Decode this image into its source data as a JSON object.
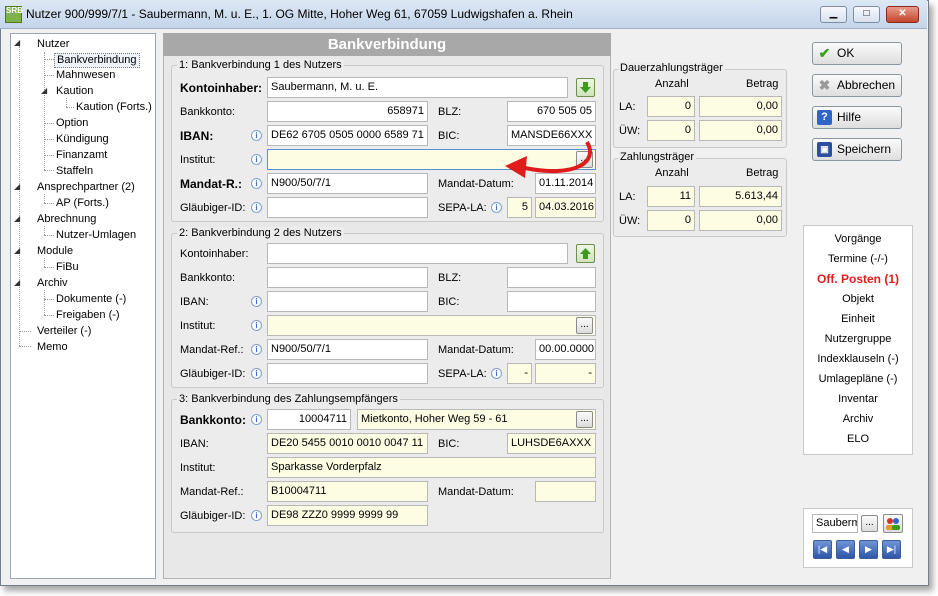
{
  "window": {
    "title": "Nutzer 900/999/7/1 - Saubermann, M. u. E., 1. OG Mitte, Hoher Weg 61, 67059 Ludwigshafen a. Rhein",
    "app_icon_text": "SRB",
    "min": "▁",
    "max": "□",
    "close": "✕"
  },
  "tree": {
    "nutzer": "Nutzer",
    "bankverbindung": "Bankverbindung",
    "mahnwesen": "Mahnwesen",
    "kaution": "Kaution",
    "kaution_forts": "Kaution (Forts.)",
    "option": "Option",
    "kuendigung": "Kündigung",
    "finanzamt": "Finanzamt",
    "staffeln": "Staffeln",
    "ansprechpartner": "Ansprechpartner (2)",
    "ap_forts": "AP (Forts.)",
    "abrechnung": "Abrechnung",
    "nutzer_umlagen": "Nutzer-Umlagen",
    "module": "Module",
    "fibu": "FiBu",
    "archiv": "Archiv",
    "dokumente": "Dokumente (-)",
    "freigaben": "Freigaben (-)",
    "verteiler": "Verteiler (-)",
    "memo": "Memo"
  },
  "main": {
    "title": "Bankverbindung"
  },
  "bank1": {
    "group_title": "1: Bankverbindung 1 des Nutzers",
    "kontoinhaber_label": "Kontoinhaber:",
    "kontoinhaber": "Saubermann, M. u. E.",
    "bankkonto_label": "Bankkonto:",
    "bankkonto": "658971",
    "blz_label": "BLZ:",
    "blz": "670 505 05",
    "iban_label": "IBAN:",
    "iban": "DE62 6705 0505 0000 6589 71",
    "bic_label": "BIC:",
    "bic": "MANSDE66XXX",
    "institut_label": "Institut:",
    "institut": "",
    "mandat_label": "Mandat-R.:",
    "mandat": "N900/50/7/1",
    "mandat_datum_label": "Mandat-Datum:",
    "mandat_datum": "01.11.2014",
    "glaeubiger_label": "Gläubiger-ID:",
    "glaeubiger": "",
    "sepa_label": "SEPA-LA:",
    "sepa_count": "5",
    "sepa_date": "04.03.2016"
  },
  "bank2": {
    "group_title": "2: Bankverbindung 2 des Nutzers",
    "kontoinhaber_label": "Kontoinhaber:",
    "kontoinhaber": "",
    "bankkonto_label": "Bankkonto:",
    "bankkonto": "",
    "blz_label": "BLZ:",
    "blz": "",
    "iban_label": "IBAN:",
    "iban": "",
    "bic_label": "BIC:",
    "bic": "",
    "institut_label": "Institut:",
    "institut": "",
    "mandat_label": "Mandat-Ref.:",
    "mandat": "N900/50/7/1",
    "mandat_datum_label": "Mandat-Datum:",
    "mandat_datum": "00.00.0000",
    "glaeubiger_label": "Gläubiger-ID:",
    "glaeubiger": "",
    "sepa_label": "SEPA-LA:",
    "sepa_count": "-",
    "sepa_date": "-"
  },
  "bank3": {
    "group_title": "3: Bankverbindung des Zahlungsempfängers",
    "bankkonto_label": "Bankkonto:",
    "bankkonto": "10004711",
    "konto_desc": "Mietkonto,  Hoher Weg 59 - 61",
    "iban_label": "IBAN:",
    "iban": "DE20 5455 0010 0010 0047 11",
    "bic_label": "BIC:",
    "bic": "LUHSDE6AXXX",
    "institut_label": "Institut:",
    "institut": "Sparkasse Vorderpfalz",
    "mandat_label": "Mandat-Ref.:",
    "mandat": "B10004711",
    "mandat_datum_label": "Mandat-Datum:",
    "mandat_datum": "",
    "glaeubiger_label": "Gläubiger-ID:",
    "glaeubiger": "DE98 ZZZ0 9999 9999 99"
  },
  "dauer": {
    "title": "Dauerzahlungsträger",
    "anzahl_label": "Anzahl",
    "betrag_label": "Betrag",
    "la_label": "LA:",
    "la_anzahl": "0",
    "la_betrag": "0,00",
    "uew_label": "ÜW:",
    "uew_anzahl": "0",
    "uew_betrag": "0,00"
  },
  "zahl": {
    "title": "Zahlungsträger",
    "anzahl_label": "Anzahl",
    "betrag_label": "Betrag",
    "la_label": "LA:",
    "la_anzahl": "11",
    "la_betrag": "5.613,44",
    "uew_label": "ÜW:",
    "uew_anzahl": "0",
    "uew_betrag": "0,00"
  },
  "buttons": {
    "ok": "OK",
    "abbrechen": "Abbrechen",
    "hilfe": "Hilfe",
    "speichern": "Speichern"
  },
  "links": {
    "vorgaenge": "Vorgänge",
    "termine": "Termine (-/-)",
    "off_posten": "Off. Posten (1)",
    "objekt": "Objekt",
    "einheit": "Einheit",
    "nutzergruppe": "Nutzergruppe",
    "indexklauseln": "Indexklauseln (-)",
    "umlageplaene": "Umlagepläne (-)",
    "inventar": "Inventar",
    "archiv": "Archiv",
    "elo": "ELO"
  },
  "search": {
    "value": "Sauberm",
    "ellipsis": "...",
    "first": "|◀",
    "prev": "◀",
    "next": "▶",
    "last": "▶|"
  },
  "colors": {
    "accent_red": "#e02020",
    "header_gray": "#a8a8a8",
    "field_yellow": "#fdfde4"
  }
}
